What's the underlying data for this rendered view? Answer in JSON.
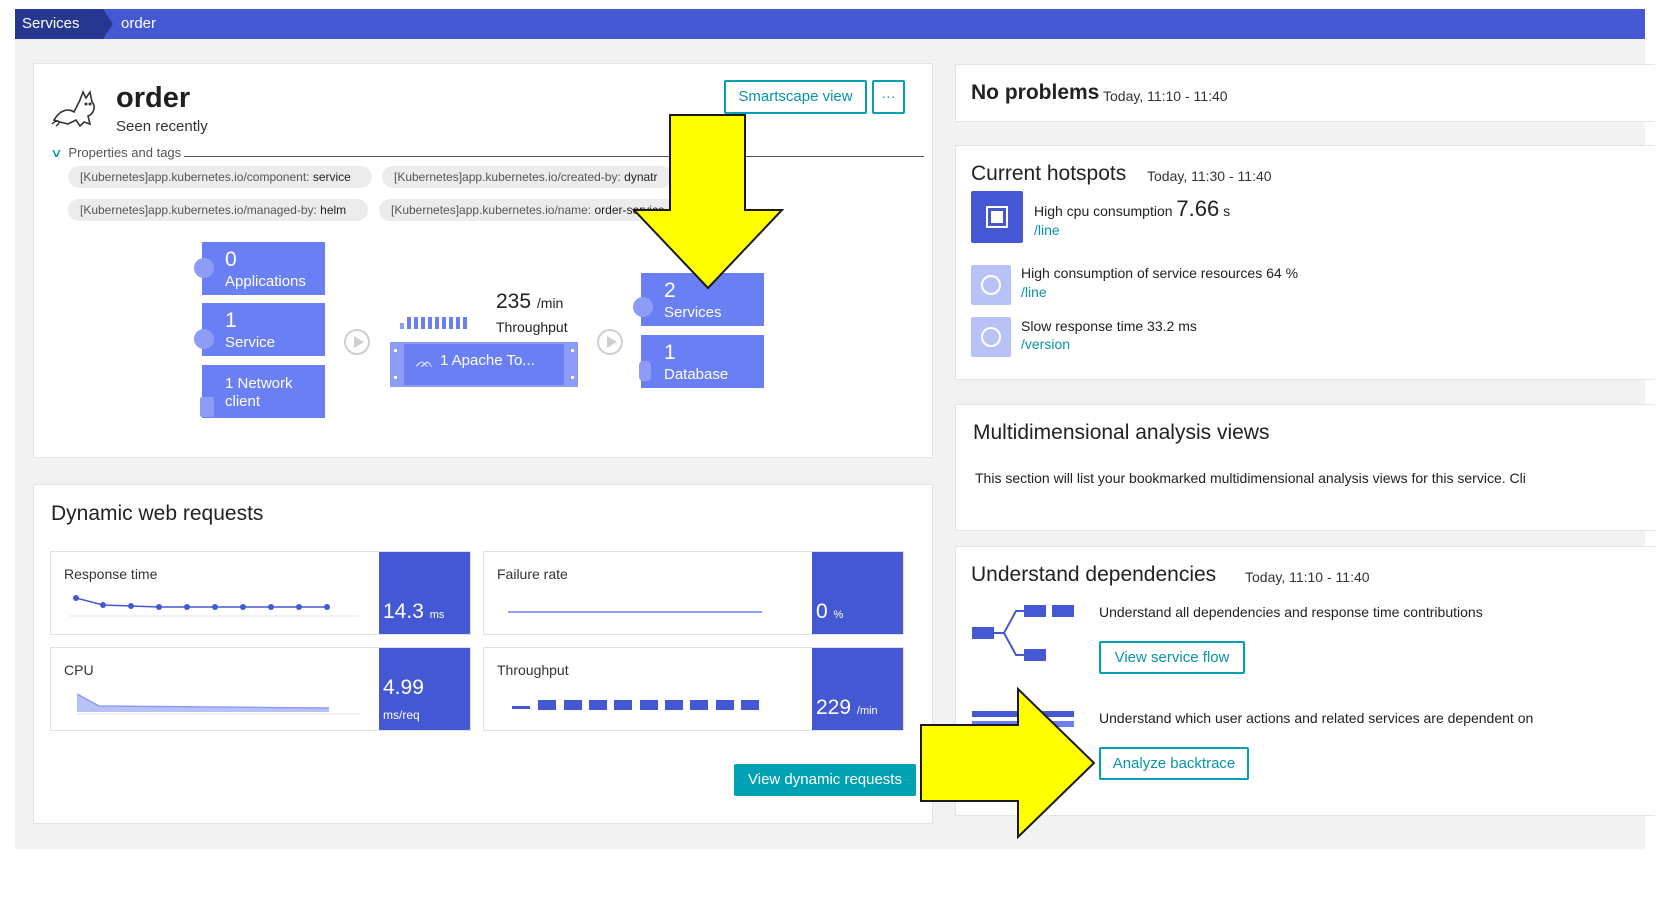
{
  "breadcrumb": {
    "first": "Services",
    "second": "order"
  },
  "order_card": {
    "title": "order",
    "subtitle": "Seen recently",
    "smartscape_label": "Smartscape view",
    "more_label": "···",
    "props_label": "Properties and tags",
    "tags": [
      {
        "key": "[Kubernetes]app.kubernetes.io/component: ",
        "value": "service"
      },
      {
        "key": "[Kubernetes]app.kubernetes.io/created-by: ",
        "value": "dynatr"
      },
      {
        "key": "[Kubernetes]app.kubernetes.io/managed-by: ",
        "value": "helm"
      },
      {
        "key": "[Kubernetes]app.kubernetes.io/name: ",
        "value": "order-service"
      }
    ],
    "callers": [
      {
        "num": "0",
        "label": "Applications"
      },
      {
        "num": "1",
        "label": "Service"
      },
      {
        "num": "",
        "label": "1 Network client"
      }
    ],
    "throughput_value": "235",
    "throughput_unit": "/min",
    "throughput_label": "Throughput",
    "process_label": "1 Apache To...",
    "callees": [
      {
        "num": "2",
        "label": "Services"
      },
      {
        "num": "1",
        "label": "Database"
      }
    ]
  },
  "dynamic_requests": {
    "title": "Dynamic web requests",
    "metrics": [
      {
        "label": "Response time",
        "value": "14.3",
        "unit": "ms"
      },
      {
        "label": "Failure rate",
        "value": "0",
        "unit": "%"
      },
      {
        "label": "CPU",
        "value": "4.99",
        "unit": "ms/req"
      },
      {
        "label": "Throughput",
        "value": "229",
        "unit": "/min"
      }
    ],
    "button_label": "View dynamic requests"
  },
  "problems": {
    "title": "No problems",
    "time": "Today, 11:10 - 11:40"
  },
  "hotspots": {
    "title": "Current hotspots",
    "time": "Today, 11:30 - 11:40",
    "items": [
      {
        "text": "High cpu consumption",
        "value": "7.66",
        "unit": "s",
        "link": "/line",
        "icon": "cpu-icon"
      },
      {
        "text": "High consumption of service resources 64 %",
        "link": "/line",
        "icon": "timer-icon"
      },
      {
        "text": "Slow response time 33.2 ms",
        "link": "/version",
        "icon": "timer-icon"
      }
    ]
  },
  "mda": {
    "title": "Multidimensional analysis views",
    "text": "This section will list your bookmarked multidimensional analysis views for this service. Cli"
  },
  "dependencies": {
    "title": "Understand dependencies",
    "time": "Today, 11:10 - 11:40",
    "flow_text": "Understand all dependencies and response time contributions",
    "flow_button": "View service flow",
    "backtrace_text": "Understand which user actions and related services are dependent on",
    "backtrace_button": "Analyze backtrace"
  },
  "colors": {
    "brand": "#4558d4",
    "tile": "#6b7ff5",
    "accent": "#00a1b2",
    "annotation": "#ffff00"
  }
}
